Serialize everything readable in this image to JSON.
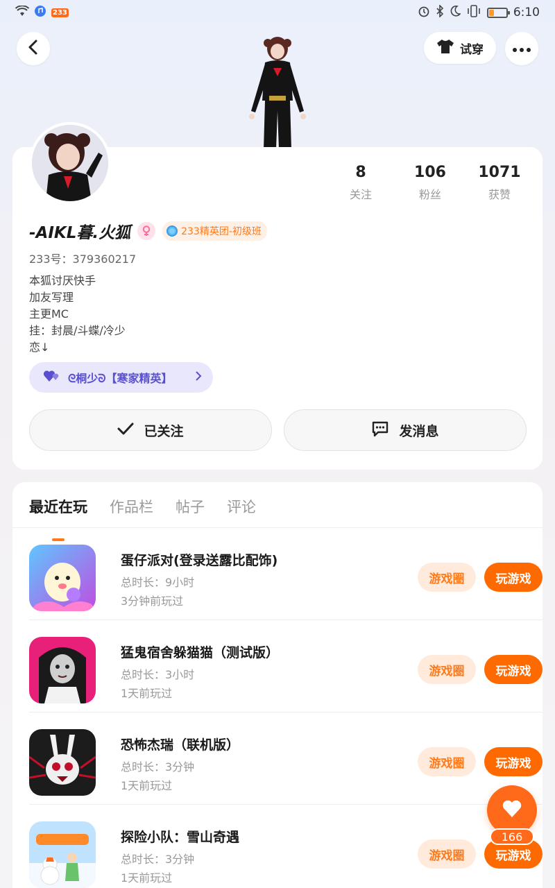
{
  "status_bar": {
    "app_badge": "233",
    "time": "6:10"
  },
  "header": {
    "tryon_label": "试穿"
  },
  "profile": {
    "stats": [
      {
        "value": "8",
        "label": "关注"
      },
      {
        "value": "106",
        "label": "粉丝"
      },
      {
        "value": "1071",
        "label": "获赞"
      }
    ],
    "name": "-AIKL暮.火狐",
    "rank_badge": "233精英团-初级班",
    "id_line": "233号：379360217",
    "bio": [
      "本狐讨厌快手",
      "加友写理",
      "主更MC",
      "挂：封晨/斗蝶/冷少",
      "恋↓"
    ],
    "relation_tag": "ᘓ桐少ᘐ【寒家精英】",
    "follow_label": "已关注",
    "message_label": "发消息"
  },
  "tabs": [
    {
      "label": "最近在玩",
      "active": true
    },
    {
      "label": "作品栏",
      "active": false
    },
    {
      "label": "帖子",
      "active": false
    },
    {
      "label": "评论",
      "active": false
    }
  ],
  "games": [
    {
      "title": "蛋仔派对(登录送露比配饰)",
      "duration": "总时长：9小时",
      "last_played": "3分钟前玩过",
      "circle_label": "游戏圈",
      "play_label": "玩游戏"
    },
    {
      "title": "猛鬼宿舍躲猫猫（测试版）",
      "duration": "总时长：3小时",
      "last_played": "1天前玩过",
      "circle_label": "游戏圈",
      "play_label": "玩游戏"
    },
    {
      "title": "恐怖杰瑞（联机版）",
      "duration": "总时长：3分钟",
      "last_played": "1天前玩过",
      "circle_label": "游戏圈",
      "play_label": "玩游戏"
    },
    {
      "title": "探险小队：雪山奇遇",
      "duration": "总时长：3分钟",
      "last_played": "1天前玩过",
      "circle_label": "游戏圈",
      "play_label": "玩游戏"
    }
  ],
  "like_fab": {
    "count": "166"
  },
  "colors": {
    "accent": "#ff6a00",
    "accent_light": "#ffeadb",
    "tag_bg": "#e9e7fb",
    "tag_fg": "#5a4fd1"
  },
  "icons": [
    "wifi-icon",
    "music-icon",
    "alarm-icon",
    "bluetooth-icon",
    "moon-icon",
    "vibrate-icon",
    "battery-icon",
    "back-icon",
    "shirt-icon",
    "more-icon",
    "hearts-icon",
    "chevron-right-icon",
    "check-icon",
    "chat-icon",
    "heart-icon"
  ]
}
